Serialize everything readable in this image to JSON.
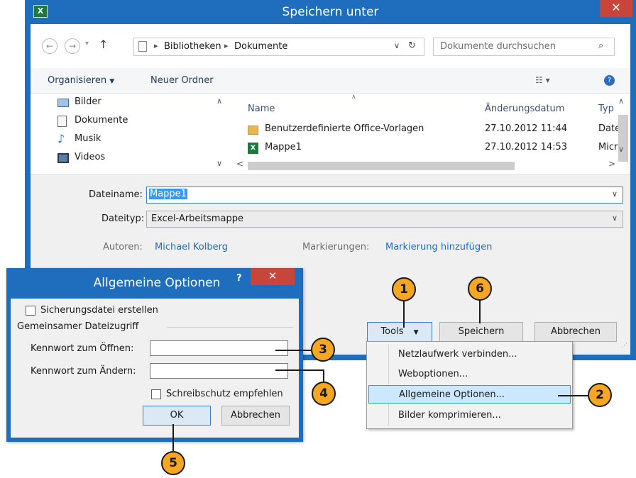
{
  "save_dialog": {
    "title": "Speichern unter",
    "breadcrumb": [
      "Bibliotheken",
      "Dokumente"
    ],
    "search_placeholder": "Dokumente durchsuchen",
    "organize_label": "Organisieren",
    "new_folder_label": "Neuer Ordner",
    "nav_items": [
      {
        "label": "Bilder",
        "icon": "pictures-icon"
      },
      {
        "label": "Dokumente",
        "icon": "documents-icon"
      },
      {
        "label": "Musik",
        "icon": "music-icon"
      },
      {
        "label": "Videos",
        "icon": "videos-icon"
      }
    ],
    "columns": {
      "name": "Name",
      "date": "Änderungsdatum",
      "type": "Typ"
    },
    "files": [
      {
        "name": "Benutzerdefinierte Office-Vorlagen",
        "date": "27.10.2012 11:44",
        "type": "Date",
        "icon": "folder-icon"
      },
      {
        "name": "Mappe1",
        "date": "27.10.2012 14:53",
        "type": "Micr",
        "icon": "excel-file-icon"
      }
    ],
    "filename_label": "Dateiname:",
    "filename_value": "Mappe1",
    "filetype_label": "Dateityp:",
    "filetype_value": "Excel-Arbeitsmappe",
    "authors_label": "Autoren:",
    "authors_value": "Michael Kolberg",
    "tags_label": "Markierungen:",
    "tags_value": "Markierung hinzufügen",
    "tools_label": "Tools",
    "save_label": "Speichern",
    "cancel_label": "Abbrechen"
  },
  "tools_menu": {
    "items": [
      "Netzlaufwerk verbinden...",
      "Weboptionen...",
      "Allgemeine Optionen...",
      "Bilder komprimieren..."
    ],
    "selected_index": 2
  },
  "options_dialog": {
    "title": "Allgemeine Optionen",
    "help_label": "?",
    "backup_label": "Sicherungsdatei erstellen",
    "backup_checked": false,
    "group_label": "Gemeinsamer Dateizugriff",
    "password_open_label": "Kennwort zum Öffnen:",
    "password_modify_label": "Kennwort zum Ändern:",
    "readonly_label": "Schreibschutz empfehlen",
    "readonly_checked": false,
    "ok_label": "OK",
    "cancel_label": "Abbrechen"
  },
  "callouts": [
    "1",
    "2",
    "3",
    "4",
    "5",
    "6"
  ],
  "colors": {
    "title_bar": "#1e6ebd",
    "close_button": "#c7453a",
    "callout_fill": "#f5a623",
    "link": "#1a6dc4",
    "selection": "#cce8ff"
  }
}
